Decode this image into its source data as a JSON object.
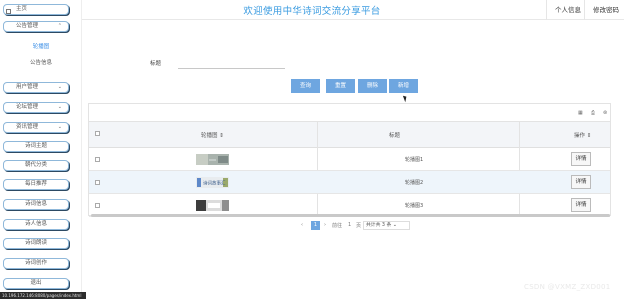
{
  "header": {
    "title": "欢迎使用中华诗词交流分享平台",
    "personal_center": "个人信息",
    "change_password": "修改密码"
  },
  "sidebar": {
    "home": "主页",
    "public_management": "公告管理",
    "sub_items": [
      {
        "label": "轮播图",
        "active": true
      },
      {
        "label": "公告信息",
        "active": false
      }
    ],
    "items": [
      {
        "label": "用户管理",
        "has_chevron": true
      },
      {
        "label": "论坛管理",
        "has_chevron": true
      },
      {
        "label": "资讯管理",
        "has_chevron": true
      },
      {
        "label": "诗词主题",
        "has_chevron": false
      },
      {
        "label": "朝代分类",
        "has_chevron": false
      },
      {
        "label": "每日推荐",
        "has_chevron": false
      },
      {
        "label": "诗词信息",
        "has_chevron": false
      },
      {
        "label": "诗人信息",
        "has_chevron": false
      },
      {
        "label": "诗词朗读",
        "has_chevron": false
      },
      {
        "label": "诗词创作",
        "has_chevron": false
      },
      {
        "label": "退出",
        "has_chevron": false
      }
    ]
  },
  "search": {
    "label": "标题",
    "value": "",
    "placeholder": ""
  },
  "buttons": {
    "query": "查询",
    "reset": "重置",
    "delete": "删除",
    "add": "新增"
  },
  "table": {
    "columns": [
      "轮播图",
      "标题",
      "操作"
    ],
    "rows": [
      {
        "title": "轮播图1",
        "action": "详情"
      },
      {
        "title": "轮播图2",
        "action": "详情"
      },
      {
        "title": "轮播图3",
        "action": "详情"
      }
    ],
    "thumb_texts": [
      "诗词故事汇"
    ]
  },
  "pagination": {
    "prev": "‹",
    "current": "1",
    "next": "›",
    "goto_label": "前往",
    "goto_page": "1",
    "page_unit": "页",
    "total": "共计共 3 条"
  },
  "status_url": "10.196.172.146:8080/pages/index.html",
  "watermark": "CSDN @VXMZ_ZXD001",
  "colors": {
    "accent": "#6ea6e0",
    "title": "#3a9be0",
    "sidebar_border": "#8fb8da",
    "row_alt": "#eef5fb"
  }
}
